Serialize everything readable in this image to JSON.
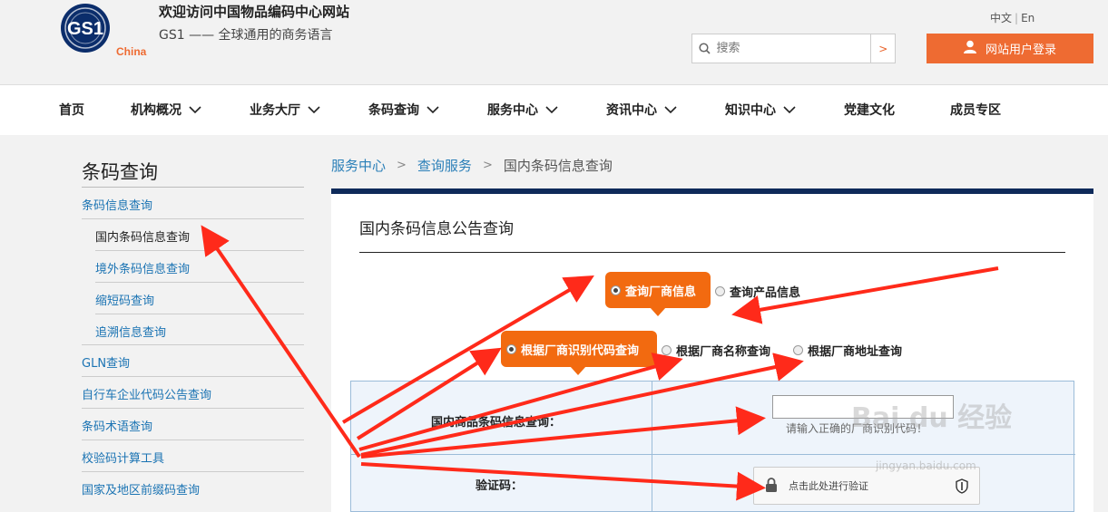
{
  "header": {
    "logo_text": "GS1",
    "logo_sub": "China",
    "title": "欢迎访问中国物品编码中心网站",
    "subtitle": "GS1 —— 全球通用的商务语言",
    "lang_cn": "中文",
    "lang_en": "En",
    "search_placeholder": "搜索",
    "search_go": ">",
    "login_label": "网站用户登录"
  },
  "nav": {
    "items": [
      {
        "label": "首页"
      },
      {
        "label": "机构概况"
      },
      {
        "label": "业务大厅"
      },
      {
        "label": "条码查询"
      },
      {
        "label": "服务中心"
      },
      {
        "label": "资讯中心"
      },
      {
        "label": "知识中心"
      },
      {
        "label": "党建文化"
      },
      {
        "label": "成员专区"
      }
    ]
  },
  "sidebar": {
    "title": "条码查询",
    "items": [
      {
        "label": "条码信息查询"
      },
      {
        "label": "国内条码信息查询"
      },
      {
        "label": "境外条码信息查询"
      },
      {
        "label": "缩短码查询"
      },
      {
        "label": "追溯信息查询"
      },
      {
        "label": "GLN查询"
      },
      {
        "label": "自行车企业代码公告查询"
      },
      {
        "label": "条码术语查询"
      },
      {
        "label": "校验码计算工具"
      },
      {
        "label": "国家及地区前缀码查询"
      }
    ]
  },
  "breadcrumb": {
    "items": [
      "服务中心",
      "查询服务",
      "国内条码信息查询"
    ],
    "separator": ">"
  },
  "main": {
    "title": "国内条码信息公告查询",
    "query_type": {
      "options": [
        "查询厂商信息",
        "查询产品信息"
      ],
      "selected": "查询厂商信息"
    },
    "query_mode": {
      "options": [
        "根据厂商识别代码查询",
        "根据厂商名称查询",
        "根据厂商地址查询"
      ],
      "selected": "根据厂商识别代码查询"
    },
    "form": {
      "code_label": "国内商品条码信息查询：",
      "code_hint": "请输入正确的厂商识别代码！",
      "captcha_label": "验证码：",
      "captcha_button": "点击此处进行验证"
    }
  },
  "watermark": {
    "text": "Bai du 经验",
    "url": "jingyan.baidu.com"
  },
  "colors": {
    "accent": "#ee6b32",
    "highlight": "#f26a10",
    "nav_dark": "#0e2a5a",
    "link": "#1a73b3",
    "arrow": "#ff2a1a"
  }
}
